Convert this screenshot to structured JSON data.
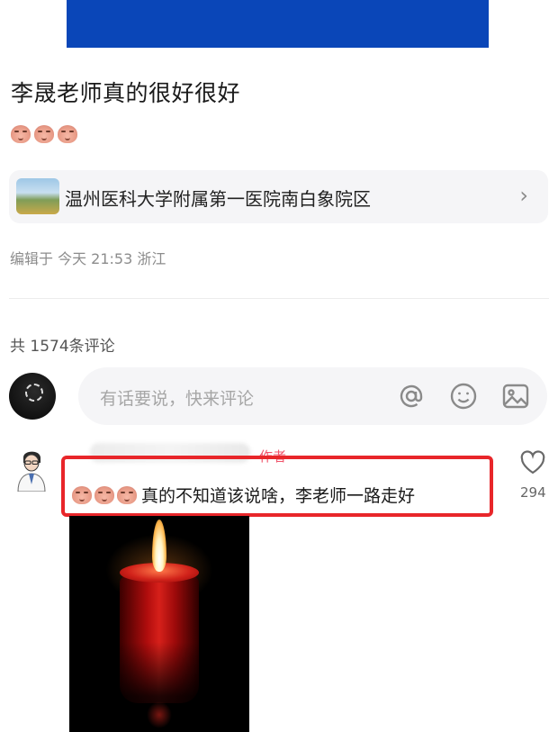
{
  "post": {
    "title": "李晟老师真的很好很好",
    "emojis": [
      "sad-face-emoji",
      "sad-face-emoji",
      "sad-face-emoji"
    ],
    "location": {
      "name": "温州医科大学附属第一医院南白象院区",
      "chevron": "›"
    },
    "edit_meta": "编辑于 今天 21:53 浙江"
  },
  "comments": {
    "count_label": "共 1574条评论",
    "input": {
      "placeholder": "有话要说，快来评论",
      "icons": [
        "at-icon",
        "smile-icon",
        "image-icon"
      ]
    },
    "items": [
      {
        "author_tag": "作者",
        "emojis": [
          "sad-face-emoji",
          "sad-face-emoji",
          "sad-face-emoji"
        ],
        "text": "真的不知道该说啥，李老师一路走好",
        "like_count": "294",
        "image": "candle-photo"
      }
    ]
  },
  "colors": {
    "banner": "#0a46b8",
    "highlight_border": "#e8262a",
    "author_tag": "#f0546b"
  }
}
